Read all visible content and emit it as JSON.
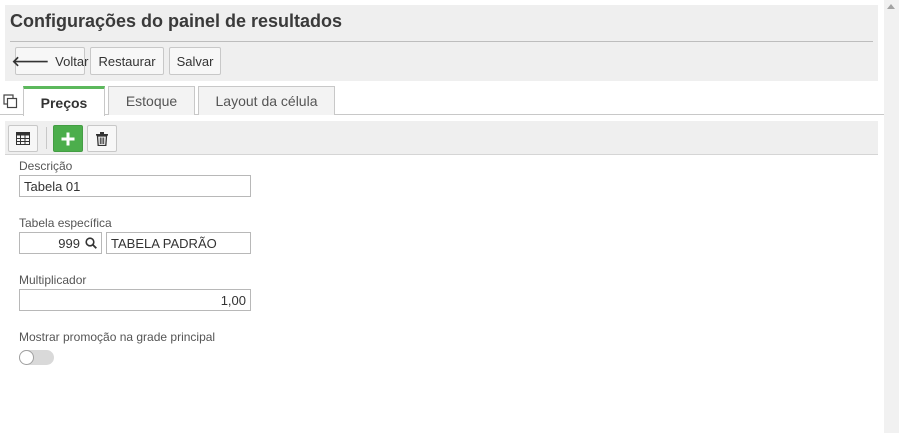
{
  "page": {
    "title": "Configurações do painel de resultados"
  },
  "toolbar": {
    "back_label": "Voltar",
    "restore_label": "Restaurar",
    "save_label": "Salvar"
  },
  "tabs": [
    {
      "label": "Preços",
      "active": true
    },
    {
      "label": "Estoque",
      "active": false
    },
    {
      "label": "Layout da célula",
      "active": false
    }
  ],
  "actions": {
    "icons": [
      "table-icon",
      "plus-icon",
      "trash-icon"
    ]
  },
  "form": {
    "descricao": {
      "label": "Descrição",
      "value": "Tabela 01"
    },
    "tabela": {
      "label": "Tabela específica",
      "code": "999",
      "name": "TABELA PADRÃO"
    },
    "multiplicador": {
      "label": "Multiplicador",
      "value": "1,00"
    },
    "promocao": {
      "label": "Mostrar promoção na grade principal",
      "checked": false
    }
  },
  "colors": {
    "accent_green": "#4cae4c",
    "header_bg": "#efefef"
  }
}
